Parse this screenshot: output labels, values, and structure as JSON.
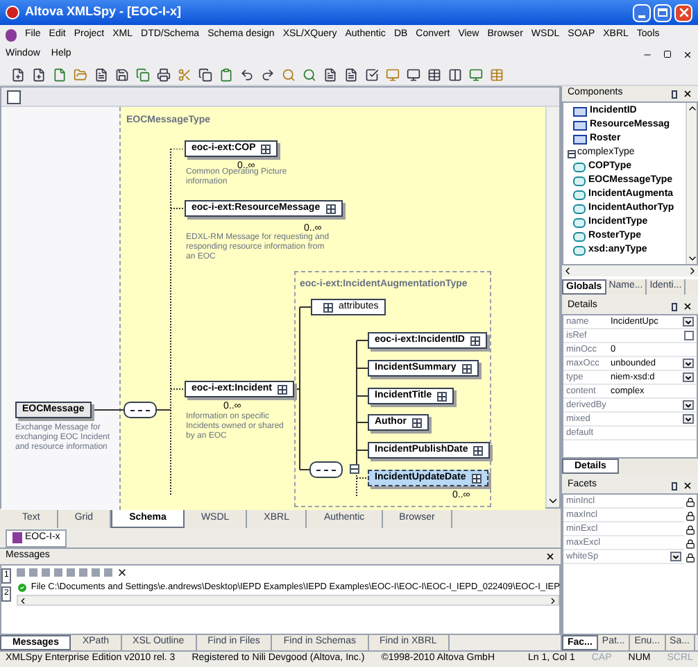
{
  "window": {
    "title": "Altova XMLSpy - [EOC-I-x]"
  },
  "menu": [
    "File",
    "Edit",
    "Project",
    "XML",
    "DTD/Schema",
    "Schema design",
    "XSL/XQuery",
    "Authentic",
    "DB",
    "Convert",
    "View",
    "Browser",
    "WSDL",
    "SOAP",
    "XBRL",
    "Tools",
    "Window",
    "Help"
  ],
  "diagram": {
    "type_label": "EOCMessageType",
    "root": {
      "name": "EOCMessage",
      "description": "Exchange Message for exchanging EOC Incident and resource information"
    },
    "elements": [
      {
        "name": "eoc-i-ext:COP",
        "occurrence": "0..∞",
        "description": "Common Operating Picture information"
      },
      {
        "name": "eoc-i-ext:ResourceMessage",
        "occurrence": "0..∞",
        "description": "EDXL-RM Message for requesting and responding resource information from an EOC"
      },
      {
        "name": "eoc-i-ext:Incident",
        "occurrence": "0..∞",
        "description": "Information on specific Incidents owned or shared by an EOC"
      }
    ],
    "inner_type": "eoc-i-ext:IncidentAugmentationType",
    "attributes_label": "attributes",
    "children": [
      {
        "name": "eoc-i-ext:IncidentID",
        "selected": false
      },
      {
        "name": "IncidentSummary",
        "selected": false
      },
      {
        "name": "IncidentTitle",
        "selected": false
      },
      {
        "name": "Author",
        "selected": false
      },
      {
        "name": "IncidentPublishDate",
        "selected": false
      },
      {
        "name": "IncidentUpdateDate",
        "selected": true,
        "occurrence": "0..∞"
      }
    ]
  },
  "view_tabs": [
    {
      "label": "Text",
      "selected": false
    },
    {
      "label": "Grid",
      "selected": false
    },
    {
      "label": "Schema",
      "selected": true
    },
    {
      "label": "WSDL",
      "selected": false
    },
    {
      "label": "XBRL",
      "selected": false
    },
    {
      "label": "Authentic",
      "selected": false
    },
    {
      "label": "Browser",
      "selected": false
    }
  ],
  "document_tab": "EOC-I-x",
  "messages": {
    "title": "Messages",
    "side_tabs": [
      "1",
      "2"
    ],
    "line": "File C:\\Documents and Settings\\e.andrews\\Desktop\\IEPD Examples\\IEPD Examples\\EOC-I\\EOC-I\\EOC-I_IEPD_022409\\EOC-I_IEP",
    "tabs": [
      {
        "label": "Messages",
        "selected": true
      },
      {
        "label": "XPath",
        "selected": false
      },
      {
        "label": "XSL Outline",
        "selected": false
      },
      {
        "label": "Find in Files",
        "selected": false
      },
      {
        "label": "Find in Schemas",
        "selected": false
      },
      {
        "label": "Find in XBRL",
        "selected": false
      }
    ]
  },
  "components": {
    "title": "Components",
    "items": [
      {
        "name": "IncidentID",
        "kind": "element"
      },
      {
        "name": "ResourceMessag",
        "kind": "element"
      },
      {
        "name": "Roster",
        "kind": "element"
      },
      {
        "name": "complexType",
        "kind": "group",
        "expanded": true,
        "children": [
          {
            "name": "COPType"
          },
          {
            "name": "EOCMessageType"
          },
          {
            "name": "IncidentAugmenta"
          },
          {
            "name": "IncidentAuthorTyp"
          },
          {
            "name": "IncidentType"
          },
          {
            "name": "RosterType"
          },
          {
            "name": "xsd:anyType"
          }
        ]
      }
    ],
    "tabs": [
      {
        "label": "Globals",
        "selected": true
      },
      {
        "label": "Name...",
        "selected": false
      },
      {
        "label": "Identi...",
        "selected": false
      }
    ]
  },
  "details": {
    "title": "Details",
    "rows": [
      {
        "label": "name",
        "value": "IncidentUpc",
        "kind": "dropdown"
      },
      {
        "label": "isRef",
        "kind": "checkbox",
        "checked": false
      },
      {
        "label": "minOcc",
        "value": "0",
        "kind": "text"
      },
      {
        "label": "maxOcc",
        "value": "unbounded",
        "kind": "dropdown"
      },
      {
        "label": "type",
        "value": "niem-xsd:d",
        "kind": "dropdown"
      },
      {
        "label": "content",
        "value": "complex",
        "kind": "text"
      },
      {
        "label": "derivedBy",
        "kind": "dropdown"
      },
      {
        "label": "mixed",
        "kind": "dropdown"
      },
      {
        "label": "default",
        "kind": "text"
      }
    ],
    "tabs": [
      {
        "label": "Details",
        "selected": true
      }
    ]
  },
  "facets": {
    "title": "Facets",
    "rows": [
      {
        "label": "minIncl",
        "kind": "text"
      },
      {
        "label": "maxIncl",
        "kind": "text"
      },
      {
        "label": "minExcl",
        "kind": "text"
      },
      {
        "label": "maxExcl",
        "kind": "text"
      },
      {
        "label": "whiteSp",
        "kind": "dropdown"
      }
    ],
    "tabs": [
      {
        "label": "Fac...",
        "selected": true
      },
      {
        "label": "Pat...",
        "selected": false
      },
      {
        "label": "Enu...",
        "selected": false
      },
      {
        "label": "Sa...",
        "selected": false
      }
    ]
  },
  "status_bar": {
    "segments": [
      "XMLSpy Enterprise Edition v2010 rel. 3",
      "Registered to Nili Devgood (Altova, Inc.)",
      "©1998-2010 Altova GmbH"
    ],
    "position": "Ln 1, Col 1",
    "indicators": [
      {
        "label": "CAP",
        "on": false
      },
      {
        "label": "NUM",
        "on": true
      },
      {
        "label": "SCRL",
        "on": false
      }
    ]
  }
}
